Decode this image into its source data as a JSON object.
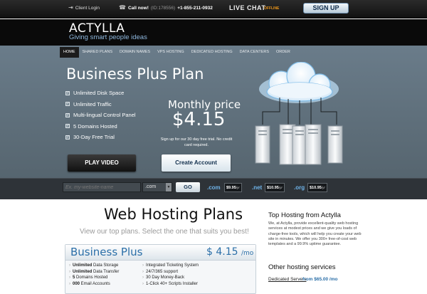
{
  "topbar": {
    "client_login": "Client Login",
    "call_now": "Call now!",
    "id_text": "(ID:178556)",
    "phone": "+1-855-211-0932",
    "live_chat": "LIVE CHAT",
    "chat_status": "OFFLINE",
    "signup": "SIGN UP"
  },
  "brand": {
    "logo": "ACTYLLA",
    "tagline": "Giving smart people ideas"
  },
  "nav": {
    "items": [
      "HOME",
      "SHARED PLANS",
      "DOMAIN NAMES",
      "VPS HOSTING",
      "DEDICATED HOSTING",
      "DATA CENTERS",
      "ORDER"
    ],
    "active": "HOME"
  },
  "hero": {
    "title": "Business Plus Plan",
    "features": [
      "Unlimited Disk Space",
      "Unlimited Traffic",
      "Multi-lingual Control Panel",
      "5 Domains Hosted",
      "30-Day Free Trial"
    ],
    "price_label": "Monthly price",
    "price": "$4.15",
    "price_note": "Sign up for our 30 day free trial. No credit card required.",
    "play_video": "PLAY VIDEO",
    "create_account": "Create Account"
  },
  "domain_search": {
    "placeholder": "Ex. my-website-name",
    "selected_tld": ".com",
    "go": "GO",
    "prices": [
      {
        "tld": ".com",
        "price": "$9.95",
        "unit": "/yr"
      },
      {
        "tld": ".net",
        "price": "$10.95",
        "unit": "/yr"
      },
      {
        "tld": ".org",
        "price": "$10.95",
        "unit": "/yr"
      }
    ]
  },
  "plans": {
    "title": "Web Hosting Plans",
    "subtitle": "View our top plans. Select the one that suits you best!",
    "card": {
      "name": "Business Plus",
      "price": "$ 4.15",
      "per": "/mo",
      "col1": [
        {
          "bold": "Unlimited",
          "text": " Data Storage"
        },
        {
          "bold": "Unlimited",
          "text": " Data Transfer"
        },
        {
          "bold": "5",
          "text": " Domains Hosted"
        },
        {
          "bold": "000",
          "text": " Email Accounts"
        }
      ],
      "col2": [
        "Integrated Ticketing System",
        "24/7/365 support",
        "30 Day Money-Back",
        "1-Click 40+ Scripts Installer"
      ]
    }
  },
  "sidebar": {
    "title": "Top Hosting from Actylla",
    "text": "We, at Actylla, provide excellent-quality web hosting services at modest prices and we give you loads of charge-free tools, which will help you create your web site in minutes. We offer you 300+ free-of-cost web templates and a 99.9% uptime guarantee.",
    "other_title": "Other hosting services",
    "link": "Dedicated Servers",
    "link_from": "- from $65.00 /mo"
  }
}
